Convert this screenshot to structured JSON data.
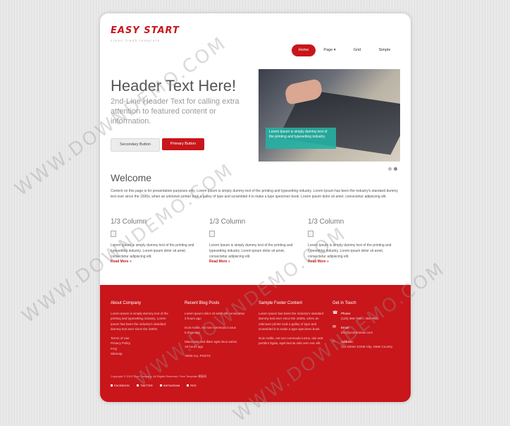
{
  "brand": {
    "name": "EASY START",
    "tagline": "clean fresh template"
  },
  "nav": {
    "items": [
      "Home",
      "Page ▾",
      "Grid",
      "Simple"
    ]
  },
  "hero": {
    "title": "Header Text Here!",
    "subtitle": "2nd-Line Header Text for calling extra attention to featured content or information.",
    "secondary_button": "Secondary Button",
    "primary_button": "Primary Button",
    "caption": "Lorem Ipsum is simply dummy text of the printing and typesetting industry."
  },
  "welcome": {
    "title": "Welcome",
    "text": "Content on this page is for presentation purposes only. Lorem Ipsum is simply dummy text of the printing and typesetting industry. Lorem Ipsum has been the industry's standard dummy text ever since the 1500s, when an unknown printer took a galley of type and scrambled it to make a type specimen book. Lorem ipsum dolor sit amet, consectetur adipiscing elit."
  },
  "columns": [
    {
      "title": "1/3 Column",
      "text": "Lorem Ipsum is simply dummy text of the printing and typesetting industry. Lorem ipsum dolor sit amet, consectetur adipiscing elit.",
      "more": "Read More »"
    },
    {
      "title": "1/3 Column",
      "text": "Lorem Ipsum is simply dummy text of the printing and typesetting industry. Lorem ipsum dolor sit amet, consectetur adipiscing elit.",
      "more": "Read More »"
    },
    {
      "title": "1/3 Column",
      "text": "Lorem Ipsum is simply dummy text of the printing and typesetting industry. Lorem ipsum dolor sit amet, consectetur adipiscing elit.",
      "more": "Read More »"
    }
  ],
  "footer": {
    "about": {
      "title": "About Company",
      "text": "Lorem Ipsum is simply dummy text of the printing and typesetting industry. Lorem Ipsum has been the industry's standard dummy text ever since the 1500s.",
      "links": [
        "Terms of Use",
        "Privacy Policy",
        "FAQ",
        "Sitemap"
      ]
    },
    "blog": {
      "title": "Recent Blog Posts",
      "posts": [
        {
          "text": "Lorem ipsum dolor sit amet elit consectetur",
          "time": "3 hours ago"
        },
        {
          "text": "Duis mollis, est non commodo luctus",
          "time": "5 days ago"
        },
        {
          "text": "Maecenas sed diam eget risus varius",
          "time": "19 hours ago"
        }
      ],
      "view_all": "VIEW ALL POSTS"
    },
    "sample": {
      "title": "Sample Footer Content",
      "p1": "Lorem Ipsum has been the industry's standard dummy text ever since the 1500s, when an unknown printer took a galley of type and scrambled it to make a type specimen book.",
      "p2": "Duis mollis, est non commodo luctus, nisi erat porttitor ligula, eget lacinia odio sem nec elit."
    },
    "contact": {
      "title": "Get in Touch",
      "phone_label": "Phone:",
      "phone": "(123) 456-7890 / 456-7891",
      "email_label": "Email:",
      "email": "info@yourdomain.com",
      "address_label": "Address:",
      "address": "123 Street 12345 City, State Country"
    },
    "copyright": "Copyright © 2013 Your Company. All Rights Reserved. Free Template 模板网",
    "social": [
      "FACEBOOK",
      "TWITTER",
      "INSTAGRAM",
      "RSS"
    ]
  },
  "watermark": "WWW.DOWNDEMO.COM",
  "colors": {
    "accent": "#c8161b",
    "caption_bg": "#23b1a3",
    "background": "#e9e9e9"
  }
}
